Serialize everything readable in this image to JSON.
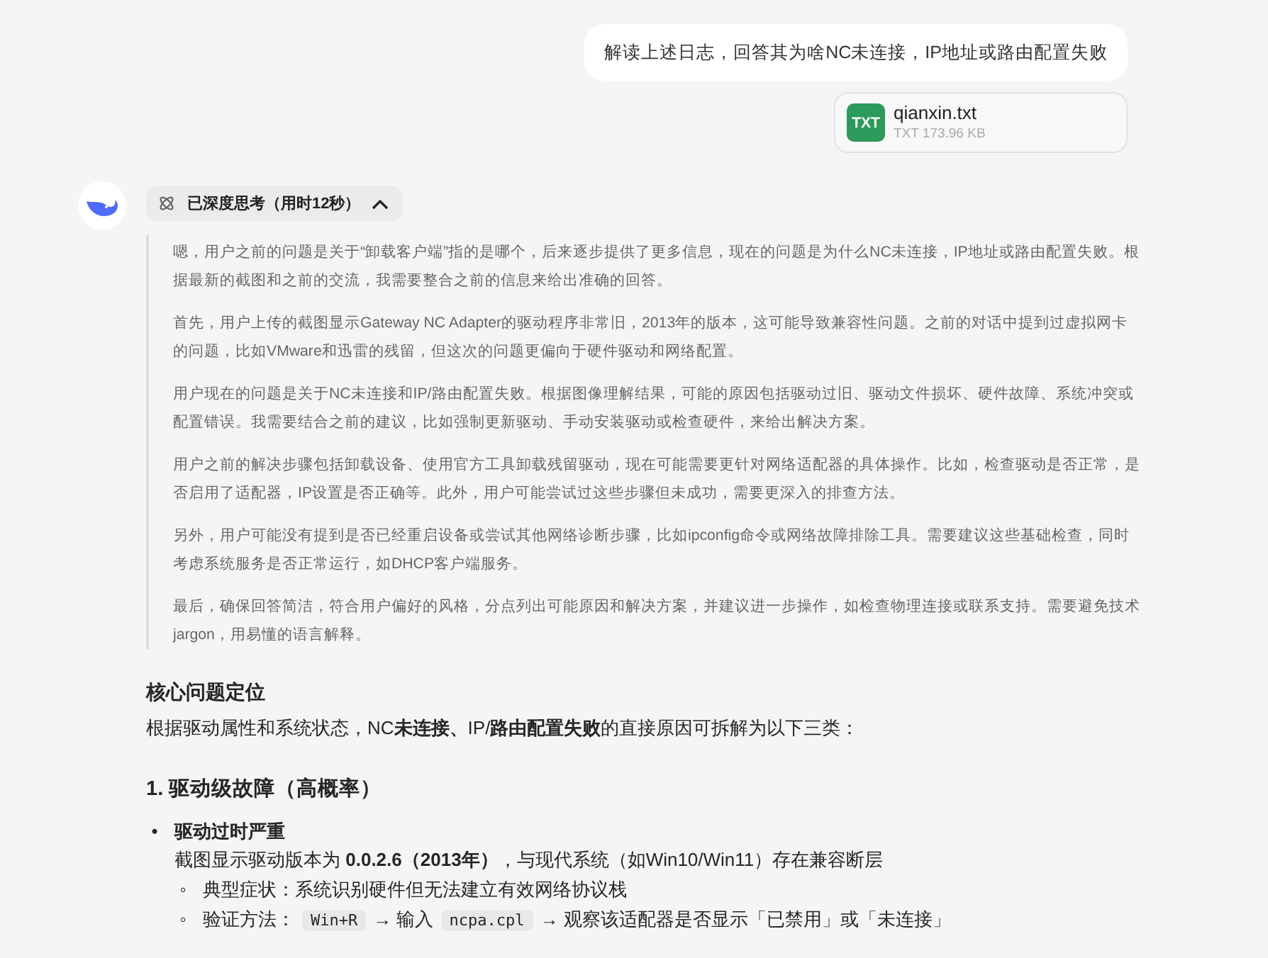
{
  "user_message": {
    "text": "解读上述日志，回答其为啥NC未连接，IP地址或路由配置失败"
  },
  "attachment": {
    "badge": "TXT",
    "name": "qianxin.txt",
    "meta": "TXT 173.96 KB"
  },
  "thinking": {
    "label": "已深度思考（用时12秒）",
    "expanded": true,
    "paragraphs": [
      "嗯，用户之前的问题是关于“卸载客户端”指的是哪个，后来逐步提供了更多信息，现在的问题是为什么NC未连接，IP地址或路由配置失败。根据最新的截图和之前的交流，我需要整合之前的信息来给出准确的回答。",
      "首先，用户上传的截图显示Gateway NC Adapter的驱动程序非常旧，2013年的版本，这可能导致兼容性问题。之前的对话中提到过虚拟网卡的问题，比如VMware和迅雷的残留，但这次的问题更偏向于硬件驱动和网络配置。",
      "用户现在的问题是关于NC未连接和IP/路由配置失败。根据图像理解结果，可能的原因包括驱动过旧、驱动文件损坏、硬件故障、系统冲突或配置错误。我需要结合之前的建议，比如强制更新驱动、手动安装驱动或检查硬件，来给出解决方案。",
      "用户之前的解决步骤包括卸载设备、使用官方工具卸载残留驱动，现在可能需要更针对网络适配器的具体操作。比如，检查驱动是否正常，是否启用了适配器，IP设置是否正确等。此外，用户可能尝试过这些步骤但未成功，需要更深入的排查方法。",
      "另外，用户可能没有提到是否已经重启设备或尝试其他网络诊断步骤，比如ipconfig命令或网络故障排除工具。需要建议这些基础检查，同时考虑系统服务是否正常运行，如DHCP客户端服务。",
      "最后，确保回答简洁，符合用户偏好的风格，分点列出可能原因和解决方案，并建议进一步操作，如检查物理连接或联系支持。需要避免技术 jargon，用易懂的语言解释。"
    ]
  },
  "answer": {
    "heading": "核心问题定位",
    "intro": "根据驱动属性和系统状态，NC**未连接、**IP/**路由配置失败**的直接原因可拆解为以下三类：",
    "section_title": "1. 驱动级故障（高概率）",
    "bullets": [
      {
        "marker": "•",
        "title": "驱动过时严重",
        "text": "截图显示驱动版本为 **0.0.2.6（2013年）**，与现代系统（如Win10/Win11）存在兼容断层",
        "sub_items": [
          {
            "marker": "◦",
            "parts": [
              {
                "kind": "text",
                "text": "典型症状：系统识别硬件但无法建立有效网络协议栈"
              }
            ]
          },
          {
            "marker": "◦",
            "parts": [
              {
                "kind": "text",
                "text": "验证方法："
              },
              {
                "kind": "code",
                "text": "Win+R"
              },
              {
                "kind": "text",
                "text": "→ 输入"
              },
              {
                "kind": "code",
                "text": "ncpa.cpl"
              },
              {
                "kind": "text",
                "text": "→ 观察该适配器是否显示「已禁用」或「未连接」"
              }
            ]
          }
        ]
      }
    ]
  }
}
